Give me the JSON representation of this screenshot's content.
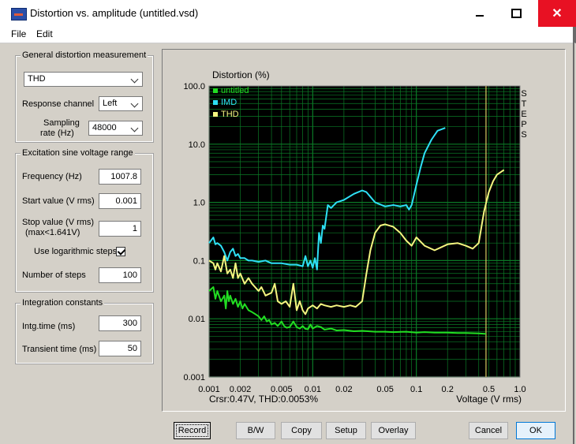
{
  "window": {
    "title": "Distortion vs. amplitude (untitled.vsd)",
    "close_glyph": "✕"
  },
  "menu": {
    "file": "File",
    "edit": "Edit"
  },
  "general": {
    "title": "General distortion measurement",
    "measurement": "THD",
    "response_label": "Response channel",
    "response_value": "Left",
    "sampling_label_1": "Sampling",
    "sampling_label_2": "rate (Hz)",
    "sampling_value": "48000"
  },
  "excitation": {
    "title": "Excitation sine voltage range",
    "frequency_label": "Frequency (Hz)",
    "frequency_value": "1007.8",
    "start_label": "Start value (V rms)",
    "start_value": "0.001",
    "stop_label_1": "Stop value (V rms)",
    "stop_label_2": "(max<1.641V)",
    "stop_value": "1",
    "log_label": "Use logarithmic steps",
    "log_checked": true,
    "steps_label": "Number of steps",
    "steps_value": "100"
  },
  "integration": {
    "title": "Integration constants",
    "intg_label": "Intg.time (ms)",
    "intg_value": "300",
    "transient_label": "Transient time (ms)",
    "transient_value": "50"
  },
  "buttons": {
    "record": "Record",
    "bw": "B/W",
    "copy": "Copy",
    "setup": "Setup",
    "overlay": "Overlay",
    "cancel": "Cancel",
    "ok": "OK"
  },
  "chart_data": {
    "type": "line",
    "ylabel": "Distortion (%)",
    "xlabel": "Voltage (V rms)",
    "side_label": "STEPS",
    "cursor_readout": "Crsr:0.47V, THD:0.0053%",
    "cursor_x": 0.47,
    "x_scale": "log",
    "y_scale": "log",
    "xlim": [
      0.001,
      1.0
    ],
    "ylim": [
      0.001,
      100.0
    ],
    "xticks": [
      [
        "0.001",
        0.001
      ],
      [
        "0.002",
        0.002
      ],
      [
        "0.005",
        0.005
      ],
      [
        "0.01",
        0.01
      ],
      [
        "0.02",
        0.02
      ],
      [
        "0.05",
        0.05
      ],
      [
        "0.1",
        0.1
      ],
      [
        "0.2",
        0.2
      ],
      [
        "0.5",
        0.5
      ],
      [
        "1.0",
        1.0
      ]
    ],
    "yticks": [
      [
        "100.0",
        100
      ],
      [
        "10.0",
        10
      ],
      [
        "1.0",
        1
      ],
      [
        "0.1",
        0.1
      ],
      [
        "0.01",
        0.01
      ],
      [
        "0.001",
        0.001
      ]
    ],
    "colors": {
      "background": "#000000",
      "grid": "#0b7a26",
      "frame": "#7f7f7f",
      "cursor": "#d8c860"
    },
    "legend_position": "top-left",
    "series": [
      {
        "name": "untitled",
        "color": "#22dd22",
        "points": [
          [
            0.001,
            0.03
          ],
          [
            0.0011,
            0.035
          ],
          [
            0.00115,
            0.022
          ],
          [
            0.0012,
            0.03
          ],
          [
            0.0013,
            0.02
          ],
          [
            0.0014,
            0.025
          ],
          [
            0.00145,
            0.015
          ],
          [
            0.0015,
            0.03
          ],
          [
            0.00155,
            0.02
          ],
          [
            0.0016,
            0.025
          ],
          [
            0.0017,
            0.018
          ],
          [
            0.0018,
            0.022
          ],
          [
            0.0019,
            0.016
          ],
          [
            0.002,
            0.02
          ],
          [
            0.0021,
            0.015
          ],
          [
            0.0022,
            0.018
          ],
          [
            0.0024,
            0.014
          ],
          [
            0.0026,
            0.013
          ],
          [
            0.0028,
            0.012
          ],
          [
            0.003,
            0.011
          ],
          [
            0.0032,
            0.0095
          ],
          [
            0.0034,
            0.011
          ],
          [
            0.0036,
            0.009
          ],
          [
            0.0038,
            0.0095
          ],
          [
            0.004,
            0.008
          ],
          [
            0.0043,
            0.0085
          ],
          [
            0.0046,
            0.0075
          ],
          [
            0.005,
            0.009
          ],
          [
            0.0053,
            0.0075
          ],
          [
            0.0056,
            0.007
          ],
          [
            0.006,
            0.0072
          ],
          [
            0.0065,
            0.009
          ],
          [
            0.007,
            0.0072
          ],
          [
            0.0075,
            0.0068
          ],
          [
            0.008,
            0.0075
          ],
          [
            0.0085,
            0.0067
          ],
          [
            0.009,
            0.0066
          ],
          [
            0.0095,
            0.008
          ],
          [
            0.01,
            0.0068
          ],
          [
            0.011,
            0.0075
          ],
          [
            0.012,
            0.0072
          ],
          [
            0.013,
            0.0065
          ],
          [
            0.015,
            0.0068
          ],
          [
            0.017,
            0.0063
          ],
          [
            0.02,
            0.0064
          ],
          [
            0.025,
            0.0061
          ],
          [
            0.03,
            0.0062
          ],
          [
            0.04,
            0.006
          ],
          [
            0.05,
            0.006
          ],
          [
            0.06,
            0.0059
          ],
          [
            0.08,
            0.006
          ],
          [
            0.1,
            0.0058
          ],
          [
            0.12,
            0.0059
          ],
          [
            0.15,
            0.0058
          ],
          [
            0.2,
            0.0058
          ],
          [
            0.25,
            0.0057
          ],
          [
            0.3,
            0.0057
          ],
          [
            0.4,
            0.0056
          ],
          [
            0.47,
            0.0055
          ]
        ]
      },
      {
        "name": "IMD",
        "color": "#2ee0f5",
        "points": [
          [
            0.001,
            0.2
          ],
          [
            0.0011,
            0.25
          ],
          [
            0.00115,
            0.19
          ],
          [
            0.0012,
            0.2
          ],
          [
            0.0013,
            0.18
          ],
          [
            0.0014,
            0.14
          ],
          [
            0.0015,
            0.1
          ],
          [
            0.0016,
            0.14
          ],
          [
            0.0017,
            0.16
          ],
          [
            0.0018,
            0.12
          ],
          [
            0.0019,
            0.13
          ],
          [
            0.002,
            0.11
          ],
          [
            0.0022,
            0.11
          ],
          [
            0.0024,
            0.1
          ],
          [
            0.0026,
            0.1
          ],
          [
            0.003,
            0.095
          ],
          [
            0.0035,
            0.1
          ],
          [
            0.004,
            0.09
          ],
          [
            0.005,
            0.09
          ],
          [
            0.006,
            0.085
          ],
          [
            0.007,
            0.085
          ],
          [
            0.008,
            0.08
          ],
          [
            0.0085,
            0.12
          ],
          [
            0.009,
            0.08
          ],
          [
            0.0095,
            0.1
          ],
          [
            0.01,
            0.075
          ],
          [
            0.0105,
            0.11
          ],
          [
            0.011,
            0.07
          ],
          [
            0.0115,
            0.3
          ],
          [
            0.012,
            0.2
          ],
          [
            0.0125,
            0.4
          ],
          [
            0.013,
            0.35
          ],
          [
            0.014,
            0.9
          ],
          [
            0.015,
            0.8
          ],
          [
            0.017,
            1.0
          ],
          [
            0.02,
            1.1
          ],
          [
            0.025,
            1.4
          ],
          [
            0.03,
            1.6
          ],
          [
            0.033,
            1.5
          ],
          [
            0.04,
            1.0
          ],
          [
            0.05,
            0.85
          ],
          [
            0.06,
            0.9
          ],
          [
            0.07,
            0.85
          ],
          [
            0.08,
            0.9
          ],
          [
            0.085,
            0.75
          ],
          [
            0.09,
            0.9
          ],
          [
            0.1,
            2.0
          ],
          [
            0.11,
            4.0
          ],
          [
            0.12,
            7.0
          ],
          [
            0.14,
            12.0
          ],
          [
            0.16,
            17.0
          ],
          [
            0.19,
            19.0
          ]
        ]
      },
      {
        "name": "THD",
        "color": "#f5f580",
        "points": [
          [
            0.001,
            0.1
          ],
          [
            0.0011,
            0.09
          ],
          [
            0.00115,
            0.07
          ],
          [
            0.0012,
            0.09
          ],
          [
            0.0013,
            0.065
          ],
          [
            0.0014,
            0.12
          ],
          [
            0.0015,
            0.06
          ],
          [
            0.0016,
            0.07
          ],
          [
            0.0017,
            0.05
          ],
          [
            0.0018,
            0.09
          ],
          [
            0.0019,
            0.05
          ],
          [
            0.002,
            0.06
          ],
          [
            0.0022,
            0.04
          ],
          [
            0.0024,
            0.05
          ],
          [
            0.0026,
            0.04
          ],
          [
            0.003,
            0.03
          ],
          [
            0.0032,
            0.035
          ],
          [
            0.0035,
            0.025
          ],
          [
            0.004,
            0.028
          ],
          [
            0.0043,
            0.04
          ],
          [
            0.0046,
            0.02
          ],
          [
            0.005,
            0.018
          ],
          [
            0.0055,
            0.02
          ],
          [
            0.006,
            0.016
          ],
          [
            0.0065,
            0.04
          ],
          [
            0.007,
            0.014
          ],
          [
            0.0075,
            0.02
          ],
          [
            0.008,
            0.014
          ],
          [
            0.0085,
            0.012
          ],
          [
            0.009,
            0.015
          ],
          [
            0.01,
            0.017
          ],
          [
            0.011,
            0.015
          ],
          [
            0.012,
            0.018
          ],
          [
            0.013,
            0.017
          ],
          [
            0.015,
            0.016
          ],
          [
            0.017,
            0.017
          ],
          [
            0.02,
            0.016
          ],
          [
            0.023,
            0.017
          ],
          [
            0.026,
            0.016
          ],
          [
            0.03,
            0.02
          ],
          [
            0.033,
            0.06
          ],
          [
            0.036,
            0.15
          ],
          [
            0.04,
            0.3
          ],
          [
            0.045,
            0.4
          ],
          [
            0.05,
            0.42
          ],
          [
            0.06,
            0.38
          ],
          [
            0.07,
            0.3
          ],
          [
            0.08,
            0.22
          ],
          [
            0.09,
            0.18
          ],
          [
            0.1,
            0.25
          ],
          [
            0.12,
            0.18
          ],
          [
            0.15,
            0.15
          ],
          [
            0.2,
            0.19
          ],
          [
            0.25,
            0.2
          ],
          [
            0.3,
            0.18
          ],
          [
            0.35,
            0.16
          ],
          [
            0.4,
            0.2
          ],
          [
            0.45,
            0.7
          ],
          [
            0.5,
            1.5
          ],
          [
            0.55,
            2.3
          ],
          [
            0.6,
            3.0
          ],
          [
            0.7,
            3.6
          ]
        ]
      }
    ]
  }
}
